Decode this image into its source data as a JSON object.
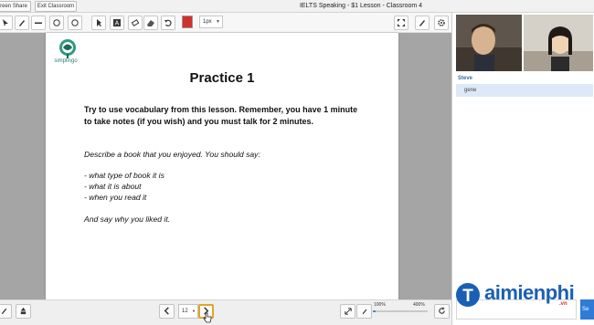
{
  "topbar": {
    "share_label": "reen Share",
    "exit_label": "Exit Classroom",
    "title": "IELTS Speaking - $1 Lesson - Classroom 4"
  },
  "toolbar": {
    "tools": [
      "pointer-icon",
      "pen-icon",
      "line-icon",
      "rectangle-icon",
      "circle-icon",
      "circle-outline-icon",
      "text-icon",
      "eraser-icon",
      "undo-icon"
    ],
    "color": "#d0312d",
    "size_value": "1px",
    "right_tools": [
      "fullscreen-icon",
      "pen-settings-icon",
      "gear-icon"
    ]
  },
  "slide": {
    "logo_text": "simplingo",
    "title": "Practice 1",
    "instructions": "Try to use vocabulary from this lesson. Remember, you have 1 minute to take notes (if you wish) and you must talk for 2 minutes.",
    "task_intro": "Describe a book that you enjoyed. You should say:",
    "task_points": [
      "- what type of book it is",
      "- what it is about",
      "- when you read it"
    ],
    "task_closing": "And say why you liked it."
  },
  "bottombar": {
    "page_value": "12",
    "zoom_min": "100%",
    "zoom_max": "400%",
    "zoom_level": 0.0
  },
  "chat": {
    "name": "Steve",
    "message": "gene",
    "send_label": "Se"
  },
  "watermark": {
    "text": "aimienphi",
    "sub": ".vn"
  }
}
